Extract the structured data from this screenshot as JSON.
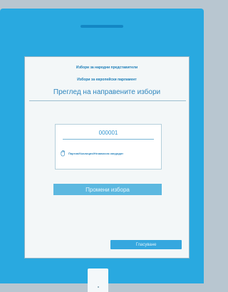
{
  "screen": {
    "heading_1": "Избори за народни представители",
    "heading_2": "Избори за европейски парламент",
    "title": "Преглед на направените избори"
  },
  "selection": {
    "number": "000001",
    "choice_label": "Партия/Коалиция/Независим кандидат"
  },
  "buttons": {
    "change": "Промени избора",
    "vote": "Гласуване"
  },
  "icons": {
    "choice": "hand-check-icon"
  },
  "colors": {
    "device": "#29a9e0",
    "accent": "#1f7fb9",
    "button": "#5cb8e0",
    "vote_button": "#35a7df"
  }
}
